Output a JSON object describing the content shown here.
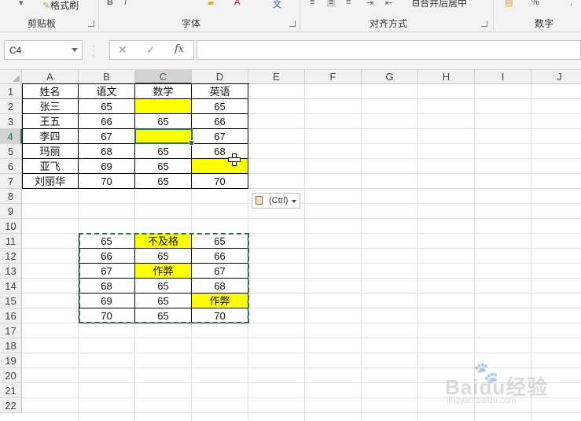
{
  "ribbon": {
    "format_painter_label": "格式刷",
    "merge_center_label": "合并后居中",
    "groups": {
      "clipboard": "剪贴板",
      "font": "字体",
      "alignment": "对齐方式",
      "number": "数字"
    }
  },
  "formula_bar": {
    "name_box": "C4",
    "fx_label": "fx",
    "cancel_symbol": "✕",
    "enter_symbol": "✓",
    "formula": ""
  },
  "columns": [
    "A",
    "B",
    "C",
    "D",
    "E",
    "F",
    "G",
    "H",
    "I",
    "J"
  ],
  "rows": [
    "1",
    "2",
    "3",
    "4",
    "5",
    "6",
    "7",
    "8",
    "9",
    "10",
    "11",
    "12",
    "13",
    "14",
    "15",
    "16",
    "17",
    "18",
    "19",
    "20",
    "21",
    "22"
  ],
  "selected_column": "C",
  "selected_row": "4",
  "table1": {
    "headers": [
      "姓名",
      "语文",
      "数学",
      "英语"
    ],
    "rows": [
      [
        "张三",
        "65",
        "",
        "65"
      ],
      [
        "王五",
        "66",
        "65",
        "66"
      ],
      [
        "李四",
        "67",
        "",
        "67"
      ],
      [
        "玛丽",
        "68",
        "65",
        "68"
      ],
      [
        "亚飞",
        "69",
        "65",
        ""
      ],
      [
        "刘丽华",
        "70",
        "65",
        "70"
      ]
    ]
  },
  "table2": {
    "rows": [
      [
        "65",
        "不及格",
        "65"
      ],
      [
        "66",
        "65",
        "66"
      ],
      [
        "67",
        "作弊",
        "67"
      ],
      [
        "68",
        "65",
        "68"
      ],
      [
        "69",
        "65",
        "作弊"
      ],
      [
        "70",
        "65",
        "70"
      ]
    ]
  },
  "paste_options_label": "(Ctrl)",
  "highlight_color": "#ffff00",
  "accent_color": "#217346",
  "watermark": {
    "brand": "Baidu经验",
    "url": "jingyan.baidu.com"
  }
}
